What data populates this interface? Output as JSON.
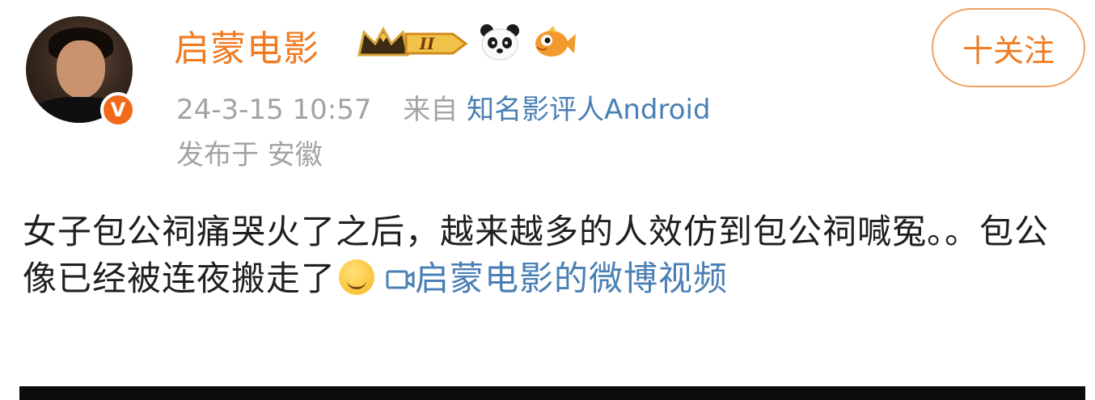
{
  "post": {
    "username": "启蒙电影",
    "follow_label": "十关注",
    "timestamp": "24-3-15 10:57",
    "source_prefix": "来自",
    "source_name": "知名影评人Android",
    "location": "发布于 安徽",
    "content_line": "女子包公祠痛哭火了之后，越来越多的人效仿到包公祠喊冤。。包公像已经被连夜搬走了",
    "video_link": "启蒙电影的微博视频",
    "badges": {
      "level_text": "II",
      "level_icon": "crown-level-badge",
      "fan_icon_1": "panda-icon",
      "fan_icon_2": "fish-icon"
    },
    "verified_mark": "V"
  },
  "colors": {
    "username": "#f07b22",
    "link": "#4a7fb5",
    "meta": "#a3a3a3",
    "verified": "#f06a1a"
  }
}
